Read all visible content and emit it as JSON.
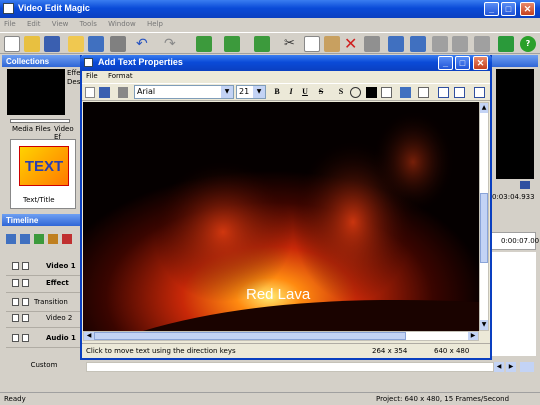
{
  "app": {
    "title": "Video Edit Magic"
  },
  "menu": [
    "File",
    "Edit",
    "View",
    "Tools",
    "Window",
    "Help"
  ],
  "collections": {
    "title": "Collections",
    "info_line1": "Effe",
    "info_line2": "Des",
    "tabs": [
      "Media Files",
      "Video Ef"
    ],
    "thumb_text": "TEXT",
    "thumb_label": "Text/Title"
  },
  "timeline": {
    "title": "Timeline",
    "time_readout": "0:00:07.00",
    "tracks": [
      "Video 1",
      "Effect",
      "Transition",
      "Video 2",
      "Audio 1"
    ],
    "zoom_label": "Custom"
  },
  "right_panel": {
    "time": "0:03:04.933"
  },
  "dialog": {
    "title": "Add Text Properties",
    "menu": [
      "File",
      "Format"
    ],
    "font": "Arial",
    "size": "21",
    "format_buttons": [
      "B",
      "I",
      "U",
      "S",
      "S"
    ],
    "overlay_text": "Red Lava",
    "status": "Click to move text using the direction keys",
    "position": "264 x 354",
    "resolution": "640 x 480"
  },
  "statusbar": {
    "left": "Ready",
    "right": "Project: 640 x 480, 15 Frames/Second"
  },
  "colors": {
    "titlebar": "#0a4bd8",
    "panel_head": "#2f66d6",
    "window_bg": "#d4d0c8"
  }
}
